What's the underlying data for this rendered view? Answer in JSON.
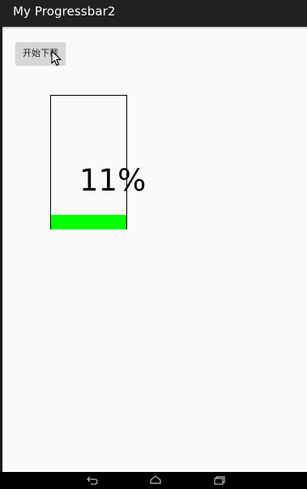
{
  "header": {
    "title": "My Progressbar2"
  },
  "main": {
    "start_button_label": "开始下载",
    "progress_text": "11%",
    "progress_fraction": 0.11,
    "fill_color": "#00ff00"
  },
  "nav": {
    "back_icon": "back-icon",
    "home_icon": "home-icon",
    "recents_icon": "recents-icon"
  }
}
